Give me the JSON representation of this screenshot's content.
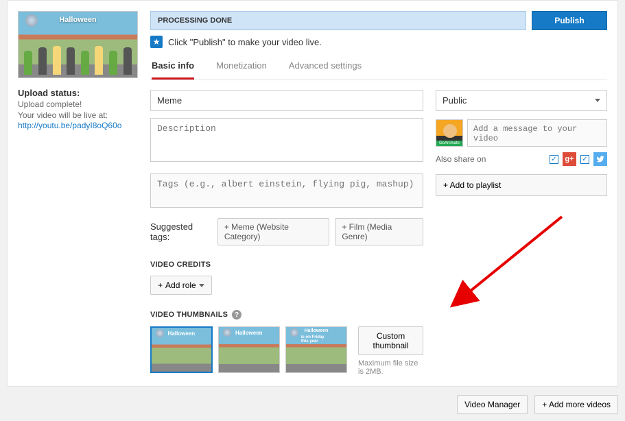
{
  "processing": {
    "status": "PROCESSING DONE",
    "publish_label": "Publish"
  },
  "info_message": "Click \"Publish\" to make your video live.",
  "tabs": {
    "basic": "Basic info",
    "monetization": "Monetization",
    "advanced": "Advanced settings"
  },
  "upload_status": {
    "label": "Upload status:",
    "complete": "Upload complete!",
    "live_text": "Your video will be live at:",
    "url": "http://youtu.be/padyI8oQ60o"
  },
  "thumb_banner": "Halloween",
  "form": {
    "title_value": "Meme",
    "desc_placeholder": "Description",
    "tags_placeholder": "Tags (e.g., albert einstein, flying pig, mashup)"
  },
  "suggested": {
    "label": "Suggested tags:",
    "tag1": "+ Meme (Website Category)",
    "tag2": "+ Film (Media Genre)"
  },
  "credits": {
    "title": "VIDEO CREDITS",
    "add_role": "Add role"
  },
  "thumbnails": {
    "title": "VIDEO THUMBNAILS",
    "custom_label": "Custom thumbnail",
    "hint": "Maximum file size is 2MB.",
    "alt_banner": "is on Friday this year"
  },
  "privacy": {
    "selected": "Public"
  },
  "share": {
    "msg_placeholder": "Add a message to your video",
    "also_label": "Also share on",
    "avatar_label": "GoAnimate"
  },
  "playlist": {
    "label": "+ Add to playlist"
  },
  "footer": {
    "video_manager": "Video Manager",
    "add_more": "+  Add more videos"
  }
}
